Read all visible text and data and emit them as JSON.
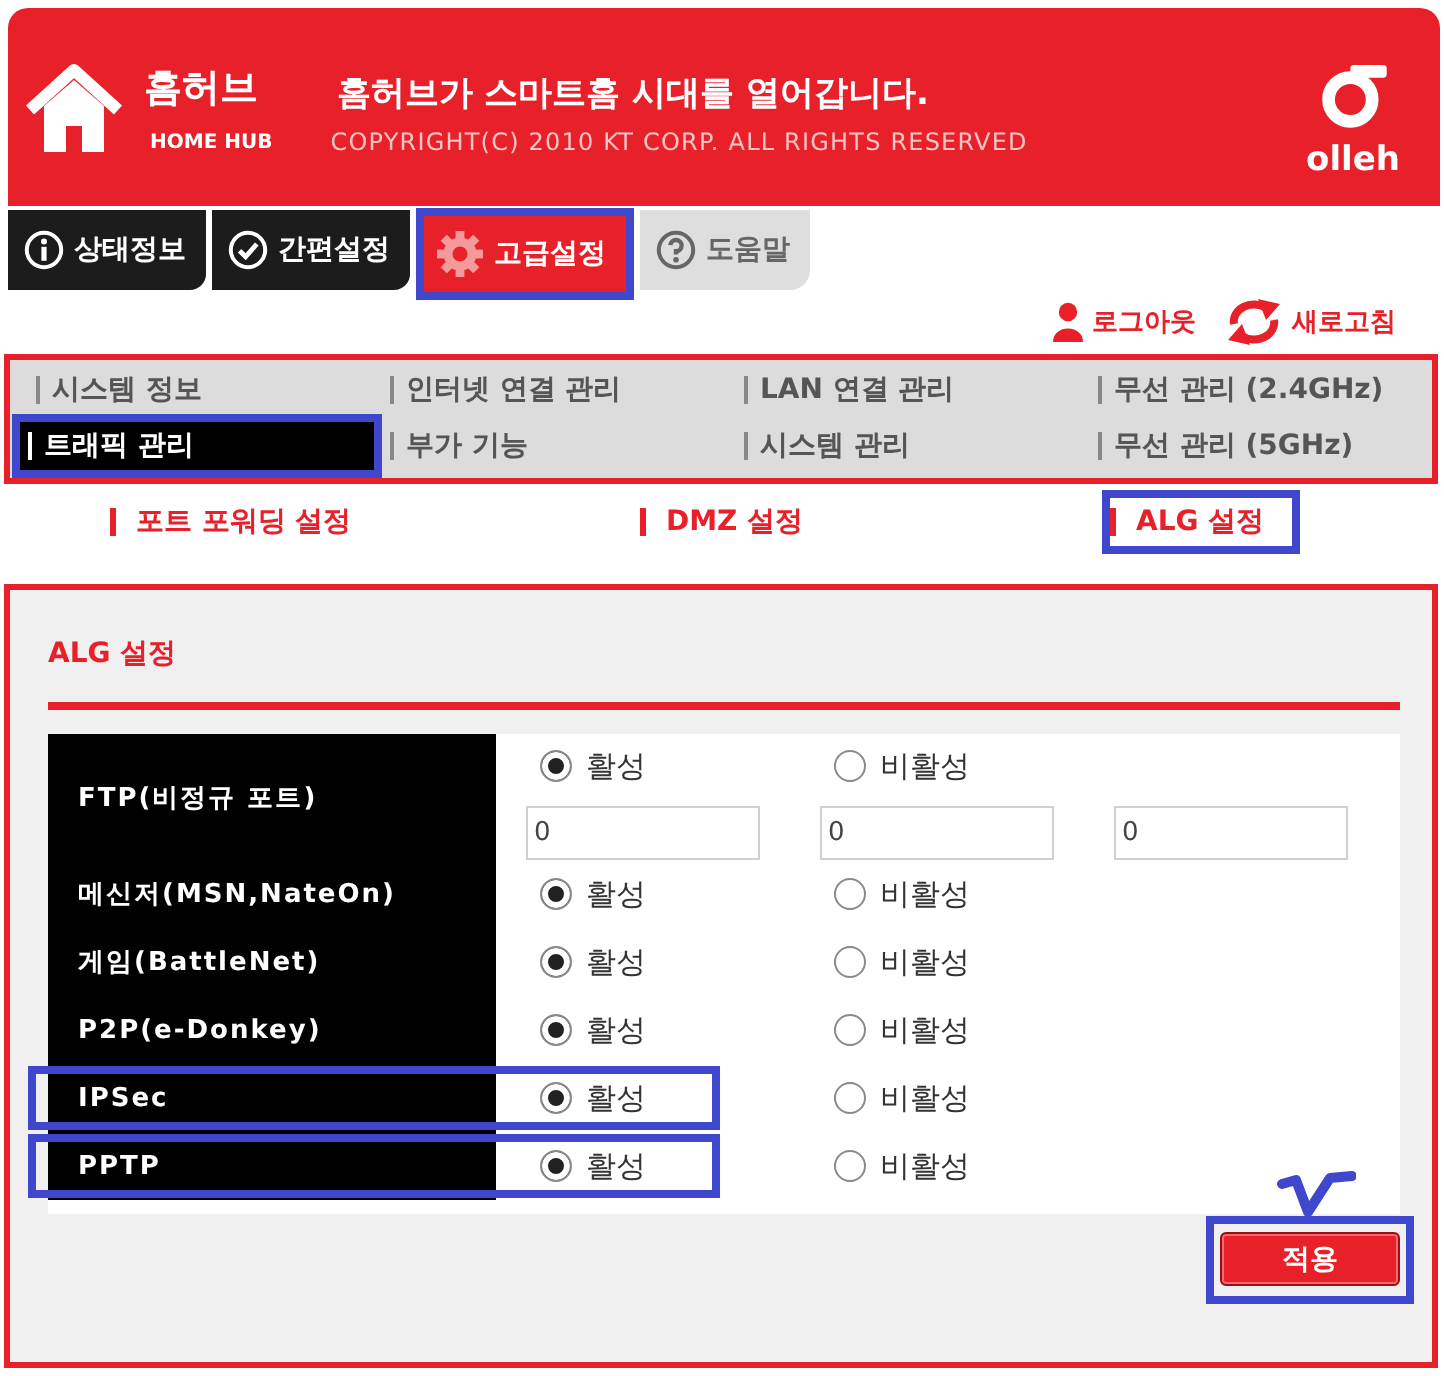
{
  "header": {
    "product_name": "홈허브",
    "product_subtitle": "HOME HUB",
    "slogan": "홈허브가 스마트홈 시대를 열어갑니다.",
    "copyright": "COPYRIGHT(C) 2010 KT CORP. ALL RIGHTS RESERVED",
    "brand": "olleh"
  },
  "main_tabs": [
    {
      "label": "상태정보",
      "kind": "menu",
      "selected": false,
      "highlighted": false
    },
    {
      "label": "간편설정",
      "kind": "menu",
      "selected": false,
      "highlighted": false
    },
    {
      "label": "고급설정",
      "kind": "menu",
      "selected": true,
      "highlighted": true
    },
    {
      "label": "도움말",
      "kind": "help",
      "selected": false,
      "highlighted": false
    }
  ],
  "account_links": [
    {
      "label": "로그아웃"
    },
    {
      "label": "새로고침"
    }
  ],
  "submenu": [
    {
      "label": "시스템 정보",
      "selected": false,
      "highlighted": false
    },
    {
      "label": "인터넷 연결 관리",
      "selected": false,
      "highlighted": false
    },
    {
      "label": "LAN 연결 관리",
      "selected": false,
      "highlighted": false
    },
    {
      "label": "무선 관리 (2.4GHz)",
      "selected": false,
      "highlighted": false
    },
    {
      "label": "트래픽 관리",
      "selected": true,
      "highlighted": true
    },
    {
      "label": "부가 기능",
      "selected": false,
      "highlighted": false
    },
    {
      "label": "시스템 관리",
      "selected": false,
      "highlighted": false
    },
    {
      "label": "무선 관리 (5GHz)",
      "selected": false,
      "highlighted": false
    }
  ],
  "subtabs": [
    {
      "label": "포트 포워딩 설정",
      "highlighted": false
    },
    {
      "label": "DMZ 설정",
      "highlighted": false
    },
    {
      "label": "ALG 설정",
      "highlighted": true
    }
  ],
  "panel": {
    "title": "ALG 설정",
    "rows": [
      {
        "label": "FTP(비정규 포트)",
        "highlighted": false,
        "options": [
          {
            "label": "활성",
            "selected": true
          },
          {
            "label": "비활성",
            "selected": false
          }
        ],
        "ports": [
          {
            "value": "0"
          },
          {
            "value": "0"
          },
          {
            "value": "0"
          }
        ]
      },
      {
        "label": "메신저(MSN,NateOn)",
        "highlighted": false,
        "options": [
          {
            "label": "활성",
            "selected": true
          },
          {
            "label": "비활성",
            "selected": false
          }
        ]
      },
      {
        "label": "게임(BattleNet)",
        "highlighted": false,
        "options": [
          {
            "label": "활성",
            "selected": true
          },
          {
            "label": "비활성",
            "selected": false
          }
        ]
      },
      {
        "label": "P2P(e-Donkey)",
        "highlighted": false,
        "options": [
          {
            "label": "활성",
            "selected": true
          },
          {
            "label": "비활성",
            "selected": false
          }
        ]
      },
      {
        "label": "IPSec",
        "highlighted": true,
        "options": [
          {
            "label": "활성",
            "selected": true
          },
          {
            "label": "비활성",
            "selected": false
          }
        ]
      },
      {
        "label": "PPTP",
        "highlighted": true,
        "options": [
          {
            "label": "활성",
            "selected": true
          },
          {
            "label": "비활성",
            "selected": false
          }
        ]
      }
    ],
    "apply_button": {
      "label": "적용",
      "highlighted": true,
      "ticked": true
    }
  }
}
